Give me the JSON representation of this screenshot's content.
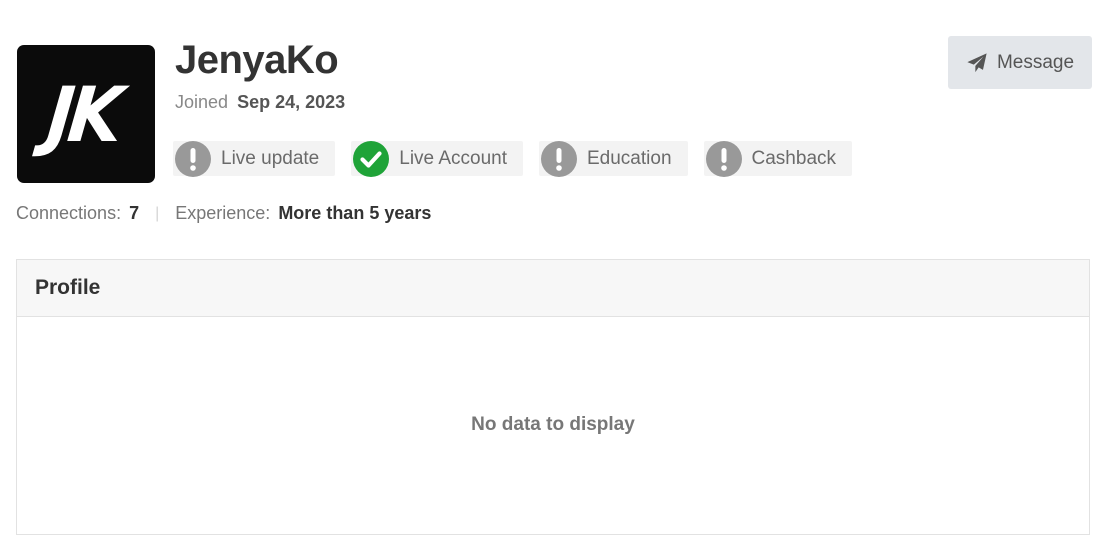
{
  "profile": {
    "avatar_initials": "JK",
    "username": "JenyaKo",
    "joined_label": "Joined",
    "joined_date": "Sep 24, 2023"
  },
  "badges": [
    {
      "label": "Live update",
      "status": "unverified",
      "icon": "exclamation-icon",
      "color": "#999999"
    },
    {
      "label": "Live Account",
      "status": "verified",
      "icon": "checkmark-icon",
      "color": "#1fa338"
    },
    {
      "label": "Education",
      "status": "unverified",
      "icon": "exclamation-icon",
      "color": "#999999"
    },
    {
      "label": "Cashback",
      "status": "unverified",
      "icon": "exclamation-icon",
      "color": "#999999"
    }
  ],
  "stats": {
    "connections_label": "Connections:",
    "connections_value": "7",
    "experience_label": "Experience:",
    "experience_value": "More than 5 years"
  },
  "actions": {
    "message_label": "Message",
    "message_icon": "paper-plane-icon"
  },
  "panel": {
    "title": "Profile",
    "empty_text": "No data to display"
  }
}
